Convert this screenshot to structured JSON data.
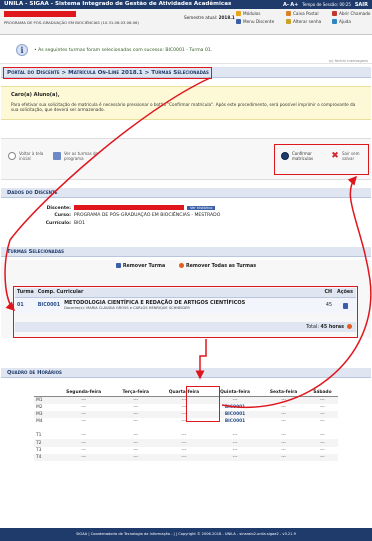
{
  "topbar": {
    "system_title": "UNILA - SIGAA - Sistema Integrado de Gestão de Atividades Acadêmicas",
    "a_minus": "A-",
    "a_plus": "A+",
    "session_label": "Tempo de Sessão:",
    "session_time": "00:25",
    "exit_label": "SAIR"
  },
  "userbar": {
    "unit": "PROGRAMA DE PÓS-GRADUAÇÃO EM BIOCIÊNCIAS (10.31.06.03.06.06)",
    "semestre_label": "Semestre atual:",
    "semestre_value": "2018.1",
    "links": [
      {
        "label": "Módulos",
        "icon": "modules-icon"
      },
      {
        "label": "Caixa Postal",
        "icon": "mailbox-icon"
      },
      {
        "label": "Abrir Chamado",
        "icon": "ticket-icon"
      },
      {
        "label": "Menu Discente",
        "icon": "menu-icon"
      },
      {
        "label": "Alterar senha",
        "icon": "key-icon"
      },
      {
        "label": "Ajuda",
        "icon": "help-icon"
      }
    ]
  },
  "message": {
    "text": "• As seguintes turmas foram selecionadas com sucesso: BIC0001 - Turma 01.",
    "close": "(x) fechar mensagens"
  },
  "breadcrumb": "Portal do Discente > Matrícula On-Line 2018.1 > Turmas Selecionadas",
  "notice": {
    "greeting": "Caro(a) Aluno(a),",
    "body": "Para efetivar sua solicitação de matrícula é necessário pressionar o botão \"Confirmar matrícula\". Após este procedimento, será possível imprimir o comprovante da sua solicitação, que deverá ser armazenado."
  },
  "actions": {
    "back_menu": "Voltar à tela inicial",
    "view_program": "Ver as turmas do programa",
    "confirm": "Confirmar matrículas",
    "exit": "Sair sem salvar"
  },
  "discente": {
    "section_title": "Dados do Discente",
    "discente_label": "Discente:",
    "history_button": "Ver histórico",
    "curso_label": "Curso:",
    "curso_value": "PROGRAMA DE PÓS-GRADUAÇÃO EM BIOCIÊNCIAS - MESTRADO",
    "curriculo_label": "Currículo:",
    "curriculo_value": "BIO1"
  },
  "turmas": {
    "section_title": "Turmas Selecionadas",
    "remove_one": "Remover Turma",
    "remove_all": "Remover Todas as Turmas",
    "headers": [
      "Turma",
      "Comp. Curricular",
      "CH",
      "Ações"
    ],
    "rows": [
      {
        "turma": "01",
        "codigo": "BIC0001",
        "nome": "METODOLOGIA CIENTÍFICA E REDAÇÃO DE ARTIGOS CIENTÍFICOS",
        "docentes": "Docente(s): MARIA CLAUDIA GROSS e CARLOS HENRIQUE SCHNEIDER",
        "ch": "45"
      }
    ],
    "total_label": "Total:",
    "total_value": "45 horas"
  },
  "horarios": {
    "section_title": "Quadro de Horários",
    "days": [
      "Segunda-feira",
      "Terça-feira",
      "Quarta-feira",
      "Quinta-feira",
      "Sexta-feira",
      "Sábado"
    ],
    "rows": [
      {
        "h": "M1",
        "c": [
          "---",
          "---",
          "---",
          "---",
          "---",
          "---"
        ]
      },
      {
        "h": "M2",
        "c": [
          "---",
          "---",
          "---",
          "BIC0001",
          "---",
          "---"
        ]
      },
      {
        "h": "M3",
        "c": [
          "---",
          "---",
          "---",
          "BIC0001",
          "---",
          "---"
        ]
      },
      {
        "h": "M4",
        "c": [
          "---",
          "---",
          "---",
          "BIC0001",
          "---",
          "---"
        ]
      },
      {
        "h": "",
        "c": [
          "",
          "",
          "",
          "",
          "",
          ""
        ]
      },
      {
        "h": "T1",
        "c": [
          "---",
          "---",
          "---",
          "---",
          "---",
          "---"
        ]
      },
      {
        "h": "T2",
        "c": [
          "---",
          "---",
          "---",
          "---",
          "---",
          "---"
        ]
      },
      {
        "h": "T3",
        "c": [
          "---",
          "---",
          "---",
          "---",
          "---",
          "---"
        ]
      },
      {
        "h": "T4",
        "c": [
          "---",
          "---",
          "---",
          "---",
          "---",
          "---"
        ]
      }
    ]
  },
  "footer": "SIGAA | Coordenadoria de Tecnologia da Informação - | | Copyright © 2006-2018 - UNILA - sinaralo2.unila.sigaa2 - v3.21.9",
  "colors": {
    "brand": "#1f3b6b",
    "highlight": "#e0161d",
    "section_bg": "#dfe6f2",
    "notice_bg": "#fdf9d6"
  }
}
